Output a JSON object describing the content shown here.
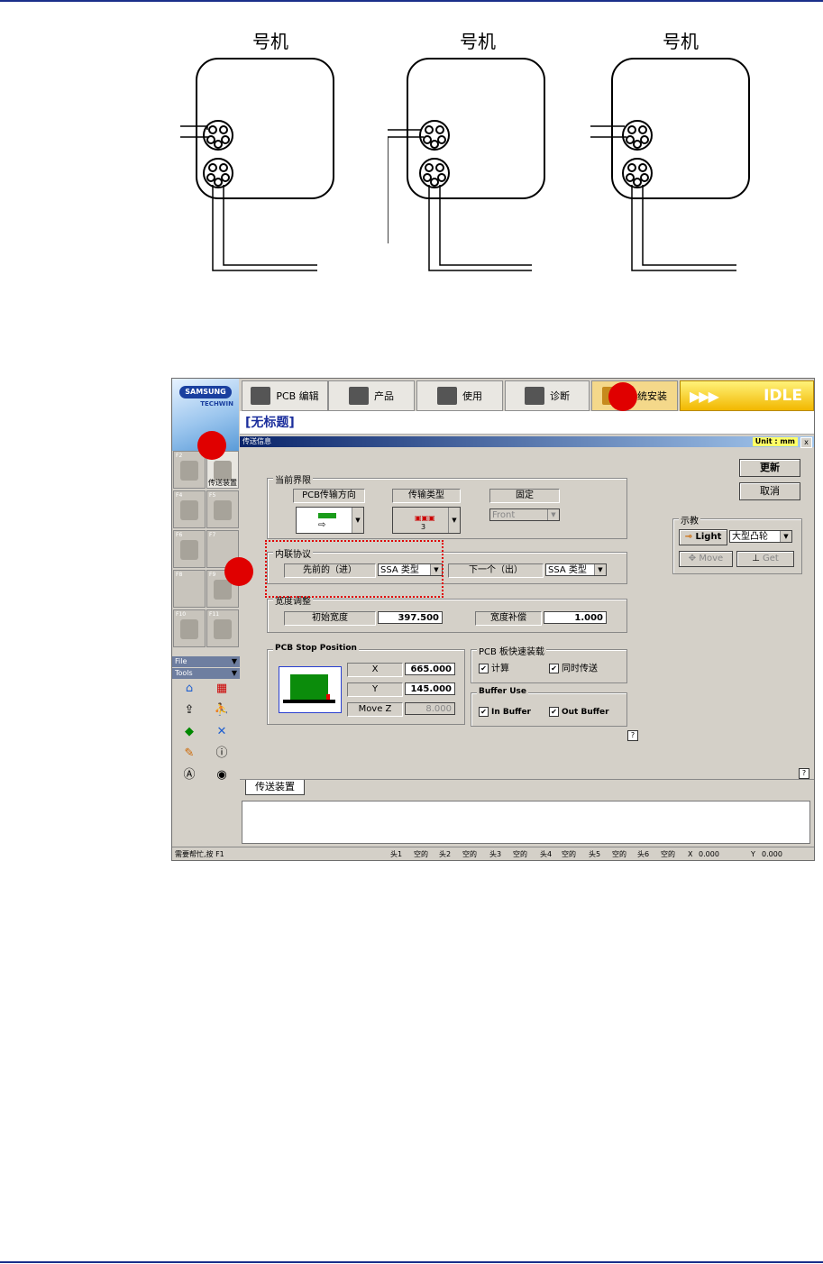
{
  "diagram": {
    "machines": [
      {
        "title": "号机"
      },
      {
        "title": "号机"
      },
      {
        "title": "号机"
      }
    ]
  },
  "app": {
    "logo": {
      "brand": "SAMSUNG",
      "sub": "TECHWIN"
    },
    "toolbar": [
      {
        "label": "PCB 编辑",
        "icon": "pcb-edit-icon"
      },
      {
        "label": "产品",
        "icon": "production-icon"
      },
      {
        "label": "使用",
        "icon": "usage-icon"
      },
      {
        "label": "诊断",
        "icon": "diagnosis-icon"
      },
      {
        "label": "系统安装",
        "icon": "system-setup-icon"
      }
    ],
    "status_indicator": {
      "arrows": "▶▶▶",
      "text": "IDLE",
      "color": "#f2b800"
    },
    "doc_title": "[无标题]",
    "sidebar": {
      "fkeys": [
        {
          "key": "F2",
          "caption": ""
        },
        {
          "key": "F3",
          "caption": "传送装置"
        },
        {
          "key": "F4",
          "caption": ""
        },
        {
          "key": "F5",
          "caption": ""
        },
        {
          "key": "F6",
          "caption": ""
        },
        {
          "key": "F7",
          "caption": ""
        },
        {
          "key": "F8",
          "caption": ""
        },
        {
          "key": "F9",
          "caption": ""
        },
        {
          "key": "F10",
          "caption": ""
        },
        {
          "key": "F11",
          "caption": ""
        }
      ],
      "menus": [
        {
          "label": "File"
        },
        {
          "label": "Tools"
        }
      ]
    },
    "dialog": {
      "title": "传送信息",
      "unit": "Unit : mm",
      "close": "x",
      "update_button": "更新",
      "cancel_button": "取消",
      "current_limit": {
        "label": "当前界限",
        "direction_header": "PCB传输方向",
        "type_header": "传输类型",
        "fixed_header": "固定",
        "type_value": "3",
        "fixed_value": "Front"
      },
      "teach": {
        "label": "示教",
        "light_button": "Light",
        "light_select": "大型凸轮",
        "move_button": "Move",
        "get_button": "Get"
      },
      "interlock": {
        "label": "内联协议",
        "prev_label": "先前的（进）",
        "prev_value": "SSA 类型",
        "next_label": "下一个（出）",
        "next_value": "SSA 类型"
      },
      "width": {
        "label": "宽度调整",
        "init_label": "初始宽度",
        "init_value": "397.500",
        "comp_label": "宽度补偿",
        "comp_value": "1.000"
      },
      "stop_position": {
        "label": "PCB Stop Position",
        "x_label": "X",
        "x_value": "665.000",
        "y_label": "Y",
        "y_value": "145.000",
        "z_label": "Move Z",
        "z_value": "8.000"
      },
      "fast_transfer": {
        "label": "PCB 板快速装载",
        "calc": "计算",
        "simul": "同时传送"
      },
      "buffer": {
        "label": "Buffer Use",
        "in": "In Buffer",
        "out": "Out Buffer"
      },
      "help": "?"
    },
    "tab": "传送装置",
    "statusbar": {
      "hint": "需要帮忙,按 F1",
      "heads": [
        {
          "h": "头1",
          "v": "空的"
        },
        {
          "h": "头2",
          "v": "空的"
        },
        {
          "h": "头3",
          "v": "空的"
        },
        {
          "h": "头4",
          "v": "空的"
        },
        {
          "h": "头5",
          "v": "空的"
        },
        {
          "h": "头6",
          "v": "空的"
        }
      ],
      "x_label": "X",
      "x_value": "0.000",
      "y_label": "Y",
      "y_value": "0.000"
    },
    "accent": "#1b2e9c",
    "highlight_color": "#e00000"
  }
}
